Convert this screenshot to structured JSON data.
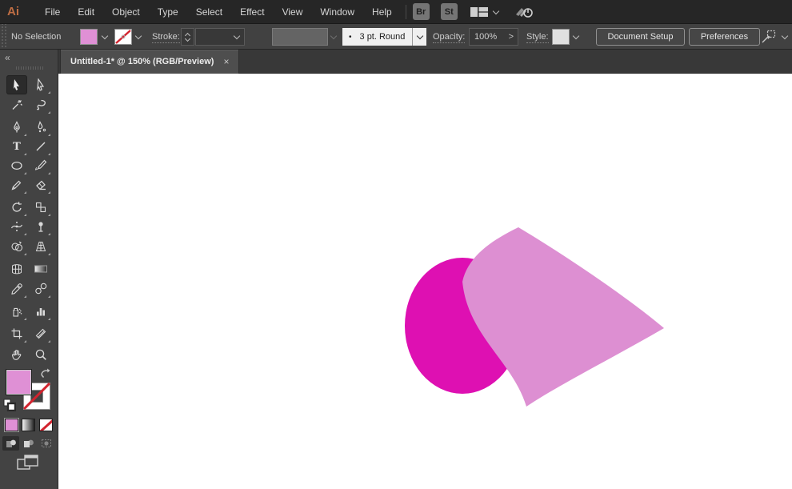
{
  "menubar": {
    "logo": "Ai",
    "items": [
      "File",
      "Edit",
      "Object",
      "Type",
      "Select",
      "Effect",
      "View",
      "Window",
      "Help"
    ],
    "bridge_label": "Br",
    "stock_label": "St"
  },
  "controlbar": {
    "selection_status": "No Selection",
    "stroke_label": "Stroke:",
    "brush_bullet": "•",
    "brush_value": "3 pt. Round",
    "opacity_label": "Opacity:",
    "opacity_value": "100%",
    "opacity_spinner": ">",
    "style_label": "Style:",
    "document_setup_label": "Document Setup",
    "preferences_label": "Preferences"
  },
  "tabbar": {
    "tab_title": "Untitled-1* @ 150% (RGB/Preview)",
    "close_glyph": "×"
  },
  "toolbar": {
    "collapse_glyph": "«",
    "type_tool_glyph": "T",
    "active_tool": "selection",
    "tools": [
      "selection",
      "direct-selection",
      "magic-wand",
      "lasso",
      "pen",
      "curvature",
      "type",
      "line-segment",
      "ellipse",
      "paintbrush",
      "shaper",
      "eraser",
      "rotate",
      "scale",
      "width",
      "puppet-warp",
      "shape-builder",
      "perspective-grid",
      "mesh",
      "gradient",
      "eyedropper",
      "blend",
      "symbol-sprayer",
      "column-graph",
      "artboard",
      "slice",
      "hand",
      "zoom"
    ]
  },
  "swatches": {
    "fill_color": "#df90d5",
    "stroke_color": "none",
    "none_diagonal_color": "#d2232e"
  },
  "canvas": {
    "zoom_percent": "150%",
    "color_mode": "RGB/Preview",
    "circle_fill": "#de10b2",
    "flag_fill": "#dd8fd2"
  }
}
